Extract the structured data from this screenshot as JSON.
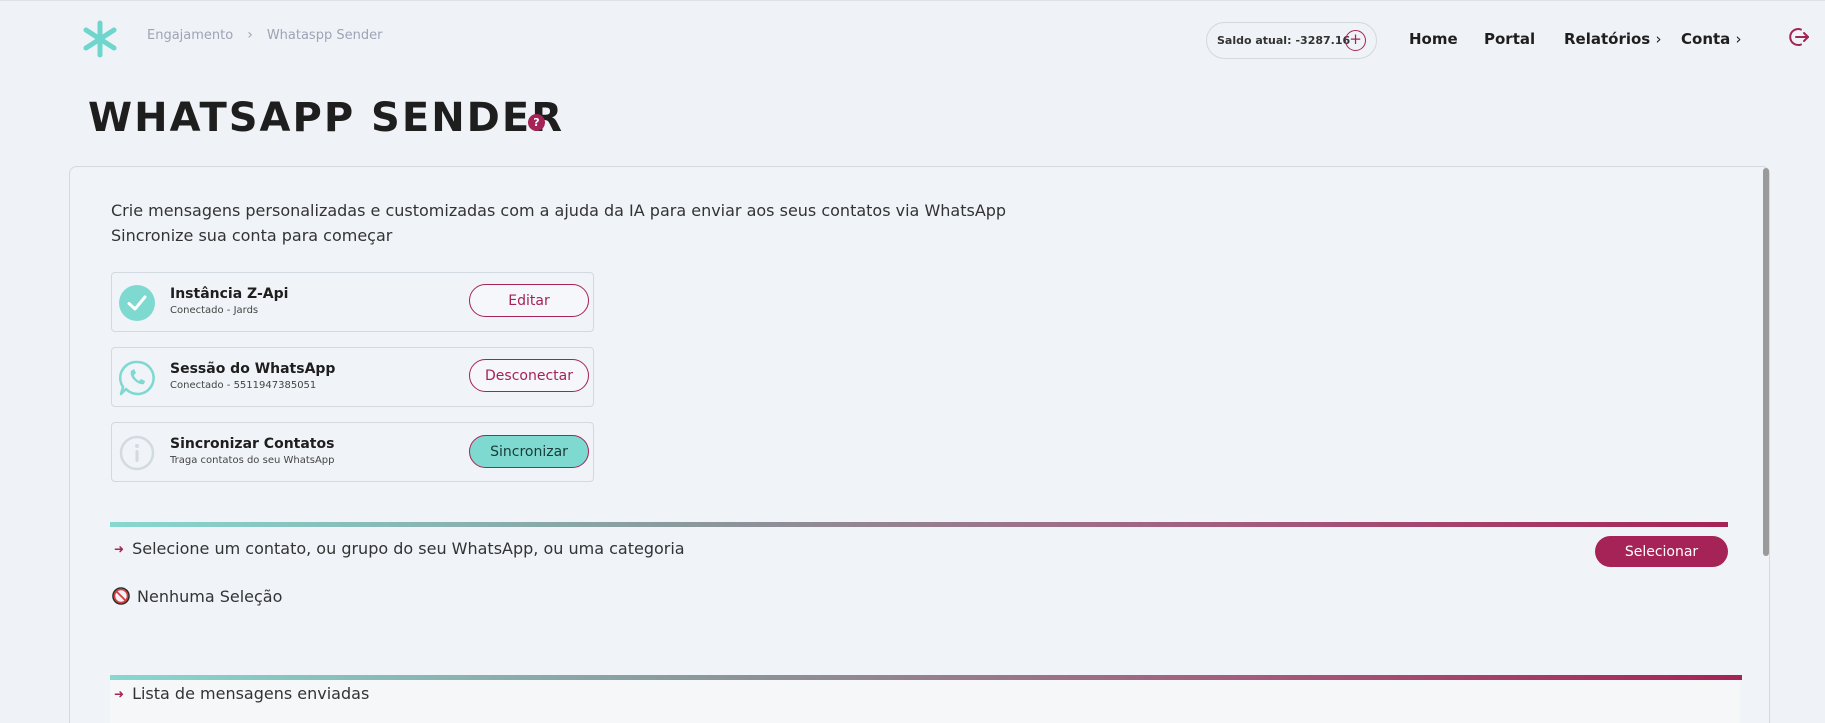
{
  "breadcrumb": [
    "Engajamento",
    "Whataspp Sender"
  ],
  "balance": {
    "label": "Saldo atual:",
    "value": "-3287.16"
  },
  "nav": {
    "home": "Home",
    "portal": "Portal",
    "reports": "Relatórios",
    "account": "Conta",
    "chevron": "›"
  },
  "page": {
    "title": "WHATSAPP SENDER",
    "help": "?"
  },
  "description": [
    "Crie mensagens personalizadas e customizadas com a ajuda da IA para enviar aos seus contatos via WhatsApp",
    "Sincronize sua conta para começar"
  ],
  "cards": [
    {
      "title": "Instância Z-Api",
      "subtitle": "Conectado - Jards",
      "button": "Editar",
      "icon": "check-circle-icon"
    },
    {
      "title": "Sessão do WhatsApp",
      "subtitle": "Conectado - 5511947385051",
      "button": "Desconectar",
      "icon": "whatsapp-icon"
    },
    {
      "title": "Sincronizar Contatos",
      "subtitle": "Traga contatos do seu WhatsApp",
      "button": "Sincronizar",
      "icon": "info-icon"
    }
  ],
  "selection": {
    "prompt": "Selecione um contato, ou grupo do seu WhatsApp, ou uma categoria",
    "button": "Selecionar",
    "empty": "Nenhuma Seleção"
  },
  "messages": {
    "title": "Lista de mensagens enviadas"
  },
  "colors": {
    "accent": "#a52356",
    "teal": "#7ed9d0",
    "background": "#eff2f6"
  }
}
